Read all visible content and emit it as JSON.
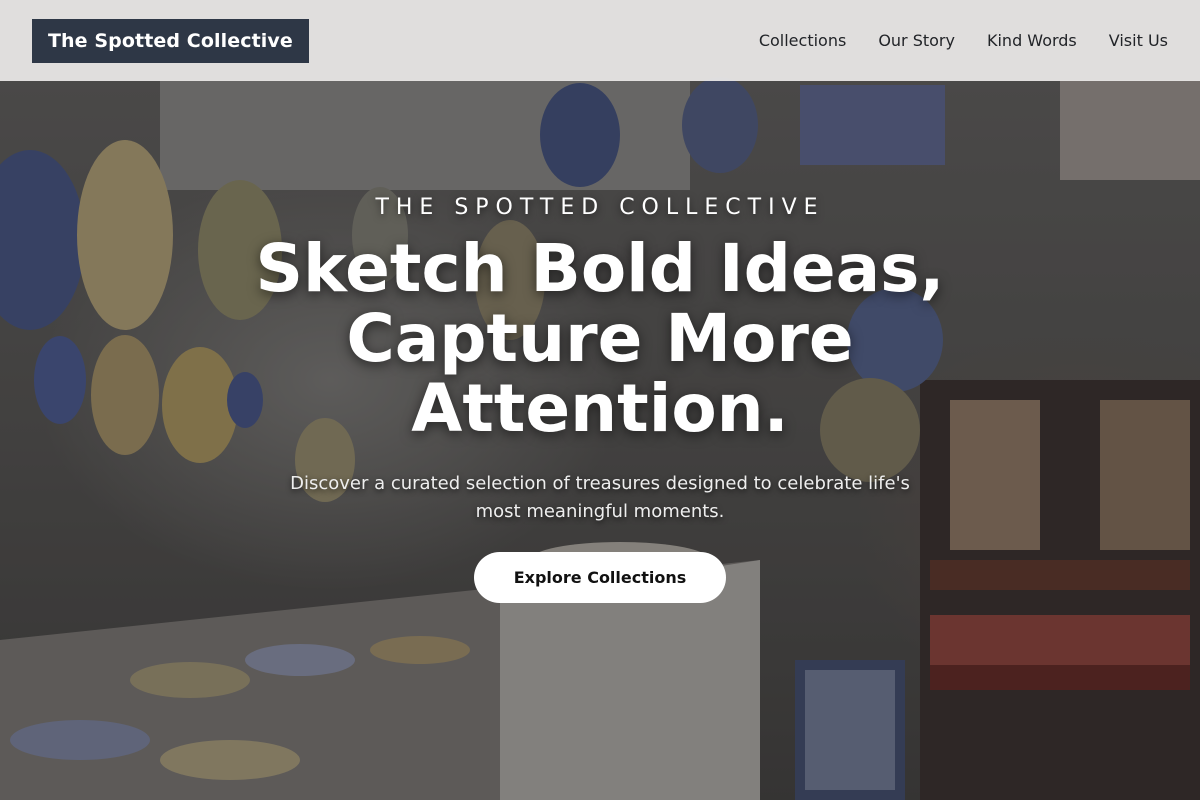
{
  "header": {
    "brand": "The Spotted Collective",
    "nav": [
      {
        "label": "Collections"
      },
      {
        "label": "Our Story"
      },
      {
        "label": "Kind Words"
      },
      {
        "label": "Visit Us"
      }
    ]
  },
  "hero": {
    "eyebrow": "THE SPOTTED COLLECTIVE",
    "headline_lines": [
      "Sketch Bold Ideas,",
      "Capture More",
      "Attention."
    ],
    "subtext": "Discover a curated selection of treasures designed to celebrate life's most meaningful moments.",
    "cta_label": "Explore Collections",
    "background_image": "ceramic-shop-photo"
  },
  "colors": {
    "brand_bg": "#2e3746",
    "nav_bg": "#ecebe8",
    "cta_bg": "#ffffff",
    "ceramic_blue": "#2f4f8f"
  }
}
